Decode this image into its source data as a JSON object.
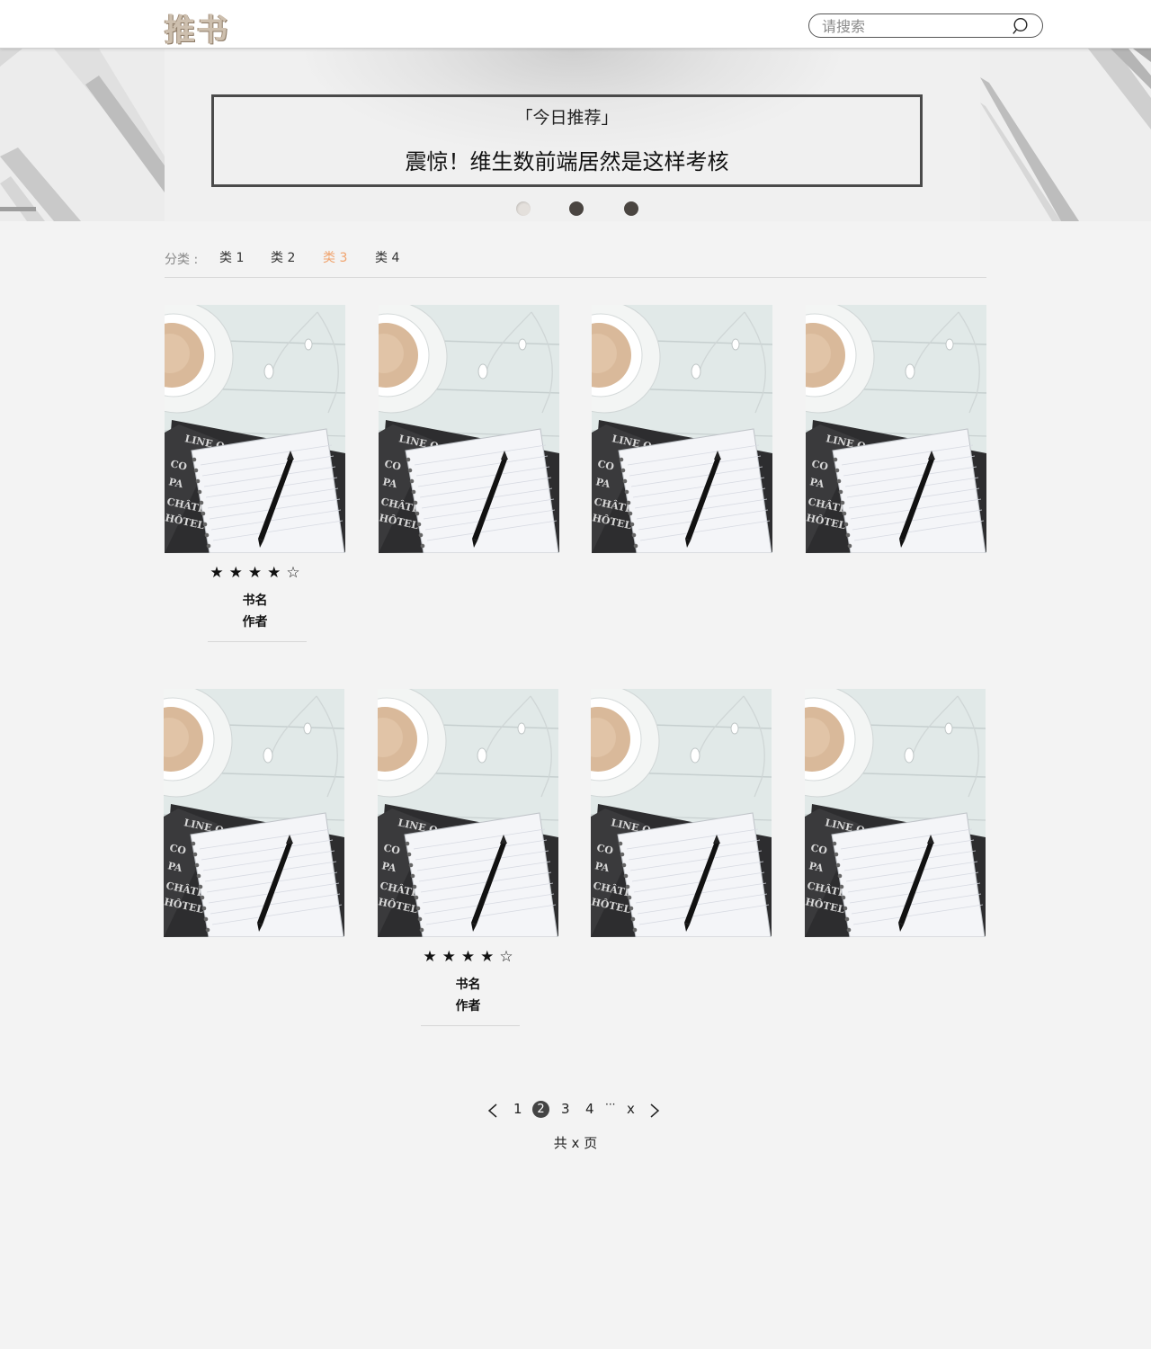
{
  "header": {
    "logo": "推书",
    "search_placeholder": "请搜索"
  },
  "banner": {
    "label": "「今日推荐」",
    "title": "震惊！维生数前端居然是这样考核",
    "slides": 3
  },
  "categories": {
    "label": "分类 :",
    "items": [
      "类 1",
      "类 2",
      "类 3",
      "类 4"
    ],
    "active_index": 2
  },
  "books": {
    "rating": 4,
    "max_rating": 5,
    "name": "书名",
    "author": "作者",
    "items": [
      {
        "shows_info": true
      },
      {
        "shows_info": false
      },
      {
        "shows_info": false
      },
      {
        "shows_info": false
      },
      {
        "shows_info": false
      },
      {
        "shows_info": true
      },
      {
        "shows_info": false
      },
      {
        "shows_info": false
      }
    ]
  },
  "pagination": {
    "pages": [
      "1",
      "2",
      "3",
      "4",
      "···",
      "x"
    ],
    "current": "2",
    "total_text": "共 x 页"
  },
  "colors": {
    "accent": "#f0a36d",
    "dark": "#444444",
    "background": "#f3f3f3"
  }
}
